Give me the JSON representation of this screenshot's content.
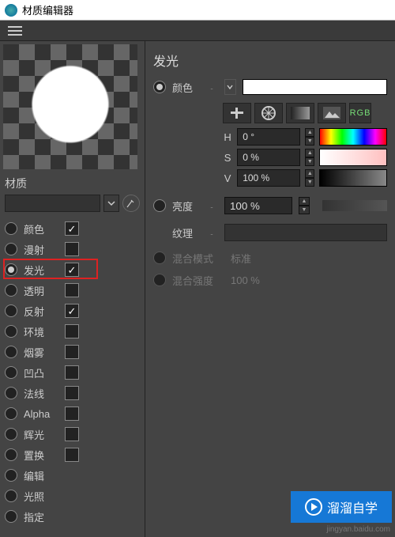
{
  "window": {
    "title": "材质编辑器"
  },
  "left": {
    "material_label": "材质",
    "channels": [
      {
        "label": "颜色",
        "checked": true,
        "selected": false
      },
      {
        "label": "漫射",
        "checked": false,
        "selected": false
      },
      {
        "label": "发光",
        "checked": true,
        "selected": true,
        "highlight": true
      },
      {
        "label": "透明",
        "checked": false,
        "selected": false
      },
      {
        "label": "反射",
        "checked": true,
        "selected": false
      },
      {
        "label": "环境",
        "checked": false,
        "selected": false
      },
      {
        "label": "烟雾",
        "checked": false,
        "selected": false
      },
      {
        "label": "凹凸",
        "checked": false,
        "selected": false
      },
      {
        "label": "法线",
        "checked": false,
        "selected": false
      },
      {
        "label": "Alpha",
        "checked": false,
        "selected": false
      },
      {
        "label": "辉光",
        "checked": false,
        "selected": false
      },
      {
        "label": "置换",
        "checked": false,
        "selected": false
      },
      {
        "label": "编辑",
        "checked": null,
        "selected": false
      },
      {
        "label": "光照",
        "checked": null,
        "selected": false
      },
      {
        "label": "指定",
        "checked": null,
        "selected": false
      }
    ]
  },
  "right": {
    "section_title": "发光",
    "color_label": "颜色",
    "h_label": "H",
    "h_value": "0 °",
    "s_label": "S",
    "s_value": "0 %",
    "v_label": "V",
    "v_value": "100 %",
    "brightness_label": "亮度",
    "brightness_value": "100 %",
    "texture_label": "纹理",
    "blend_mode_label": "混合模式",
    "blend_mode_value": "标准",
    "blend_strength_label": "混合强度",
    "blend_strength_value": "100 %",
    "rgb_label": "RGB"
  },
  "watermark": {
    "brand": "溜溜自学",
    "url": "jingyan.baidu.com"
  }
}
